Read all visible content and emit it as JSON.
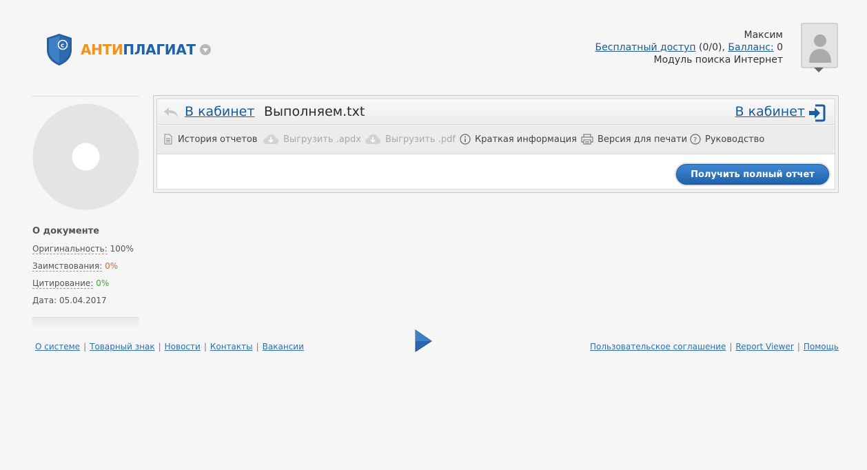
{
  "header": {
    "logo_part1": "АНТИ",
    "logo_part2": "ПЛАГИАТ",
    "user_name": "Максим",
    "free_access_label": "Бесплатный доступ",
    "free_access_value": " (0/0), ",
    "balance_label": "Балланс:",
    "balance_value": " 0",
    "module": "Модуль поиска Интернет"
  },
  "sidebar": {
    "doc_title": "О документе",
    "originality_label": "Оригинальность:",
    "originality_value": "100%",
    "borrowing_label": "Заимствования:",
    "borrowing_value": "0%",
    "citation_label": "Цитирование:",
    "citation_value": "0%",
    "date_label": "Дата:",
    "date_value": "05.04.2017"
  },
  "panel": {
    "to_cabinet_left": "В кабинет",
    "filename": "Выполняем.txt",
    "to_cabinet_right": "В кабинет",
    "toolbar": {
      "history": "История отчетов",
      "export_apdx": "Выгрузить .apdx",
      "export_pdf": "Выгрузить .pdf",
      "brief_info": "Краткая информация",
      "print_version": "Версия для печати",
      "guide": "Руководство"
    },
    "get_full_report": "Получить полный отчет"
  },
  "footer": {
    "left": [
      "О системе",
      "Товарный знак",
      "Новости",
      "Контакты",
      "Вакансии"
    ],
    "right": [
      "Пользовательское соглашение",
      "Report Viewer",
      "Помощь"
    ]
  },
  "colors": {
    "brand_orange": "#f0921f",
    "brand_blue": "#2062a8",
    "link_blue": "#1a5a96",
    "green": "#4aa23a",
    "orange": "#e06520"
  }
}
